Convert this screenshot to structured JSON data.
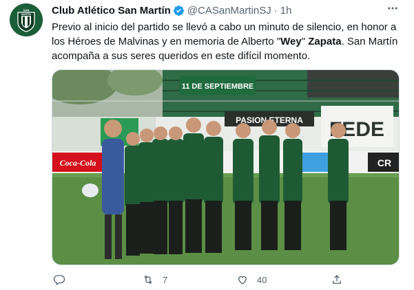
{
  "tweet": {
    "display_name": "Club Atlético San Martín",
    "handle": "@CASanMartinSJ",
    "separator": "·",
    "time": "1h",
    "more_icon": "more-icon",
    "avatar_text_top": "SAN",
    "avatar_text_bottom": "MARTÍN",
    "text_part1": "Previo al inicio del partido se llevó a cabo un minuto de silencio, en honor a los Héroes de Malvinas y en memoria de Alberto \"",
    "text_bold1": "Wey",
    "text_part2": "\" ",
    "text_bold2": "Zapata",
    "text_part3": ". San Martín acompaña a sus seres queridos en este difícil momento.",
    "media": {
      "description_icon": "team-photo",
      "banner_top": "11 DE SEPTIEMBRE",
      "banner_mid": "PASION ETERNA",
      "banner_right": "FEDE",
      "ad_left": "Coca-Cola",
      "ad_right": "CR"
    },
    "actions": {
      "reply_count": "",
      "retweet_count": "7",
      "like_count": "40"
    },
    "colors": {
      "brand_green": "#1b5e3a",
      "verified_blue": "#1d9bf0",
      "muted": "#536471"
    }
  }
}
